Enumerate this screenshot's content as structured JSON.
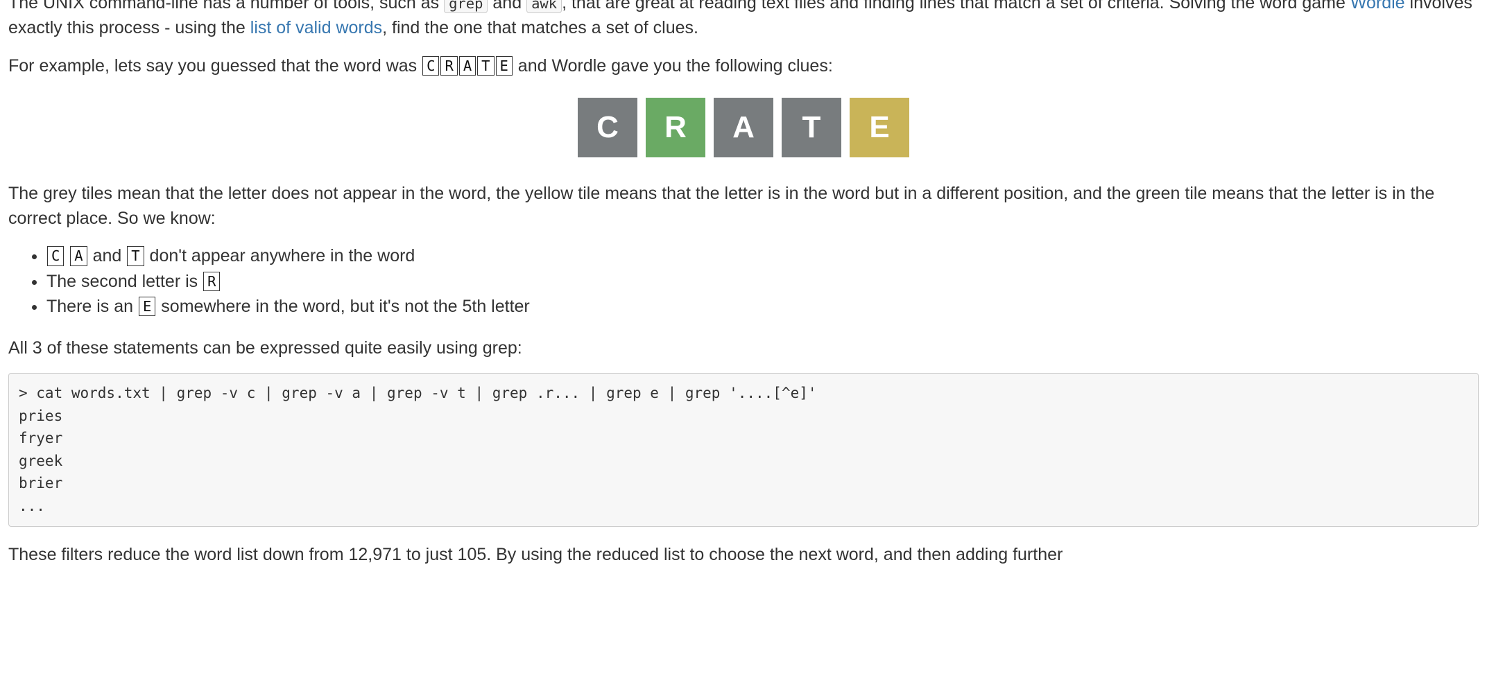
{
  "p1": {
    "a": "The UNIX command-line has a number of tools, such as ",
    "code1": "grep",
    "b": " and ",
    "code2": "awk",
    "c": ", that are great at reading text files and finding lines that match a set of criteria. Solving the word game ",
    "link1": "Wordle",
    "d": " involves exactly this process - using the ",
    "link2": "list of valid words",
    "e": ", find the one that matches a set of clues."
  },
  "p2": {
    "a": "For example, lets say you guessed that the word was ",
    "k": [
      "C",
      "R",
      "A",
      "T",
      "E"
    ],
    "b": " and Wordle gave you the following clues:"
  },
  "tiles": [
    {
      "letter": "C",
      "state": "absent"
    },
    {
      "letter": "R",
      "state": "correct"
    },
    {
      "letter": "A",
      "state": "absent"
    },
    {
      "letter": "T",
      "state": "absent"
    },
    {
      "letter": "E",
      "state": "present"
    }
  ],
  "p3": "The grey tiles mean that the letter does not appear in the word, the yellow tile means that the letter is in the word but in a different position, and the green tile means that the letter is in the correct place. So we know:",
  "list": {
    "li1": {
      "k1": "C",
      "k2": "A",
      "mid": " and ",
      "k3": "T",
      "tail": " don't appear anywhere in the word"
    },
    "li2": {
      "a": "The second letter is ",
      "k": "R"
    },
    "li3": {
      "a": "There is an ",
      "k": "E",
      "b": " somewhere in the word, but it's not the 5th letter"
    }
  },
  "p4": "All 3 of these statements can be expressed quite easily using grep:",
  "code": "> cat words.txt | grep -v c | grep -v a | grep -v t | grep .r... | grep e | grep '....[^e]'\npries\nfryer\ngreek\nbrier\n...",
  "p5": "These filters reduce the word list down from 12,971 to just 105. By using the reduced list to choose the next word, and then adding further"
}
